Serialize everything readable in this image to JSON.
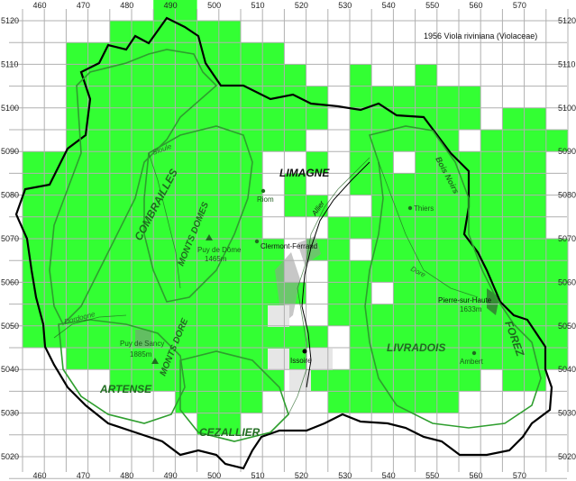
{
  "title": "1956 Viola riviniana (Violaceae)",
  "x_ticks": [
    "460",
    "470",
    "480",
    "490",
    "500",
    "510",
    "520",
    "530",
    "540",
    "550",
    "560",
    "570"
  ],
  "y_ticks": [
    "5120",
    "5110",
    "5100",
    "5090",
    "5080",
    "5070",
    "5060",
    "5050",
    "5040",
    "5030",
    "5020"
  ],
  "regions": {
    "limagne": "LIMAGNE",
    "combrailles": "COMBRAILLES",
    "monts_domes": "MONTS DOMES",
    "monts_dore": "MONTS DORE",
    "artense": "ARTENSE",
    "cezallier": "CEZALLIER",
    "livradois": "LIVRADOIS",
    "forez": "FOREZ",
    "bois_noirs": "Bois Noirs"
  },
  "places": {
    "riom": "Riom",
    "clermont": "Clermont-Ferrand",
    "puy_de_dome": "Puy de Dôme",
    "puy_de_dome_alt": "1465m",
    "puy_de_sancy": "Puy de Sancy",
    "puy_de_sancy_alt": "1885m",
    "issoire": "Issoire",
    "thiers": "Thiers",
    "ambert": "Ambert",
    "pierre_sur_haute": "Pierre-sur-Haute",
    "pierre_sur_haute_alt": "1633m"
  },
  "rivers": {
    "sioule": "Sioule",
    "allier": "Allier",
    "dore": "Dore",
    "dordogne": "Dordogne"
  },
  "colors": {
    "presence": "#33ff33",
    "grid": "#b0b0b0",
    "border": "#000000",
    "region_outline": "#2e9e2e"
  }
}
